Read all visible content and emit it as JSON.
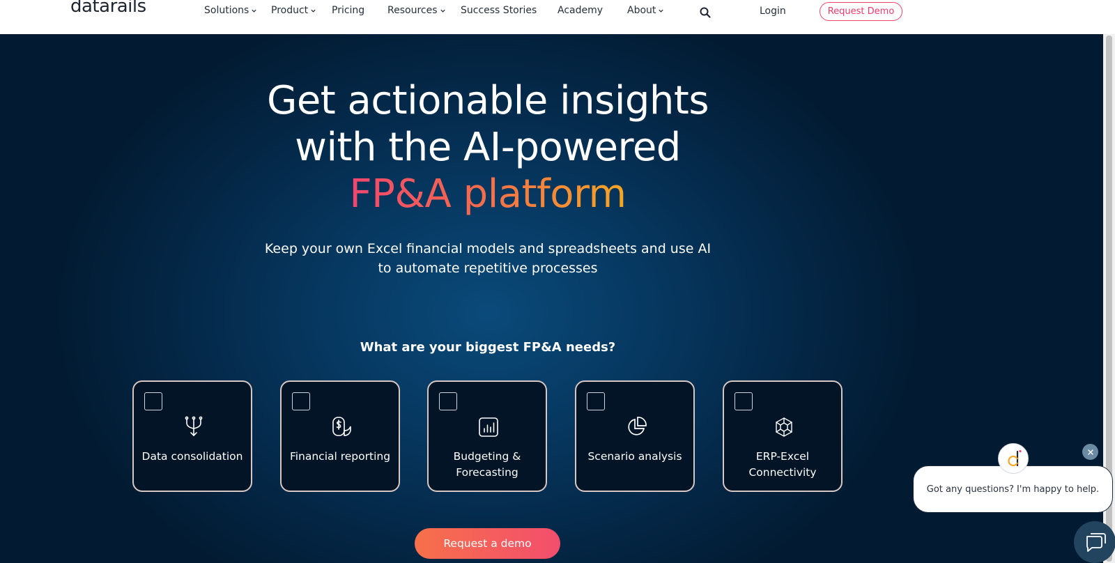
{
  "nav": {
    "logo": "datarails",
    "items": [
      {
        "label": "Solutions",
        "dropdown": true
      },
      {
        "label": "Product",
        "dropdown": true
      },
      {
        "label": "Pricing",
        "dropdown": false
      },
      {
        "label": "Resources",
        "dropdown": true
      },
      {
        "label": "Success Stories",
        "dropdown": false
      },
      {
        "label": "Academy",
        "dropdown": false
      },
      {
        "label": "About",
        "dropdown": true
      }
    ],
    "login": "Login",
    "request_demo": "Request Demo"
  },
  "hero": {
    "headline_line1": "Get actionable insights",
    "headline_line2": "with the AI-powered",
    "headline_highlight": "FP&A platform",
    "subtitle_line1": "Keep your own Excel financial models and spreadsheets and use AI",
    "subtitle_line2": "to automate repetitive processes",
    "question": "What are your biggest FP&A needs?",
    "needs": [
      {
        "label_line1": "Data consolidation",
        "label_line2": "",
        "icon": "merge-arrows-icon",
        "checked": false
      },
      {
        "label_line1": "Financial reporting",
        "label_line2": "",
        "icon": "dollar-document-icon",
        "checked": false
      },
      {
        "label_line1": "Budgeting &",
        "label_line2": "Forecasting",
        "icon": "bar-chart-icon",
        "checked": false
      },
      {
        "label_line1": "Scenario analysis",
        "label_line2": "",
        "icon": "pie-chart-icon",
        "checked": false
      },
      {
        "label_line1": "ERP-Excel",
        "label_line2": "Connectivity",
        "icon": "network-cube-icon",
        "checked": false
      }
    ],
    "cta": "Request a demo"
  },
  "chat": {
    "message": "Got any questions? I'm happy to help."
  },
  "colors": {
    "accent_pink": "#f0426b",
    "accent_orange": "#f5a623",
    "background_navy": "#021c33"
  }
}
